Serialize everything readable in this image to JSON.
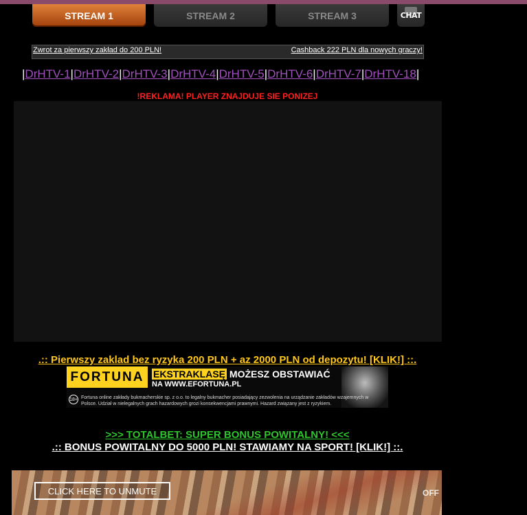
{
  "tabs": [
    {
      "label": "STREAM 1",
      "active": true
    },
    {
      "label": "STREAM 2",
      "active": false
    },
    {
      "label": "STREAM 3",
      "active": false
    }
  ],
  "chat": {
    "label": "CHAT",
    "icon": "chat-bubble-icon"
  },
  "promo_bar": {
    "left": "Zwrot za pierwszy zakład do 200 PLN!",
    "right": "Cashback 222 PLN dla nowych graczy!"
  },
  "channel_links": [
    "DrHTV-1",
    "DrHTV-2",
    "DrHTV-3",
    "DrHTV-4",
    "DrHTV-5",
    "DrHTV-6",
    "DrHTV-7",
    "DrHTV-18"
  ],
  "ad_notice": "!REKLAMA! PLAYER ZNAJDUJE SIE PONIZEJ",
  "promo1": ".:: Pierwszy zaklad bez ryzyka 200 PLN + az 2000 PLN od depozytu! [KLIK!] ::.",
  "banner": {
    "logo": "FORTUNA",
    "headline_highlight": "EKSTRAKLASĘ",
    "headline_rest": "MOŻESZ OBSTAWIAĆ",
    "subhead": "NA WWW.EFORTUNA.PL",
    "age": "18+",
    "legal": "Fortuna online zakłady bukmacherskie sp. z o.o. to legalny bukmacher posiadający zezwolenia na urządzanie zakładów wzajemnych w Polsce. Udział w nielegalnych grach hazardowych grozi konsekwencjami prawnymi. Hazard związany jest z ryzykiem."
  },
  "promo2": ">>> TOTALBET: SUPER BONUS POWITALNY! <<<",
  "promo3": ".:: BONUS POWITALNY DO 5000 PLN! STAWIAMY NA SPORT! [KLIK!] ::.",
  "video2": {
    "unmute_label": "CLICK HERE TO UNMUTE",
    "watermark": "OFF"
  },
  "colors": {
    "accent_tab": "#c8641e",
    "link": "#a24fbf",
    "warning": "#ff2020",
    "promo_gold": "#ffc61a",
    "promo_green": "#2dc42d"
  }
}
